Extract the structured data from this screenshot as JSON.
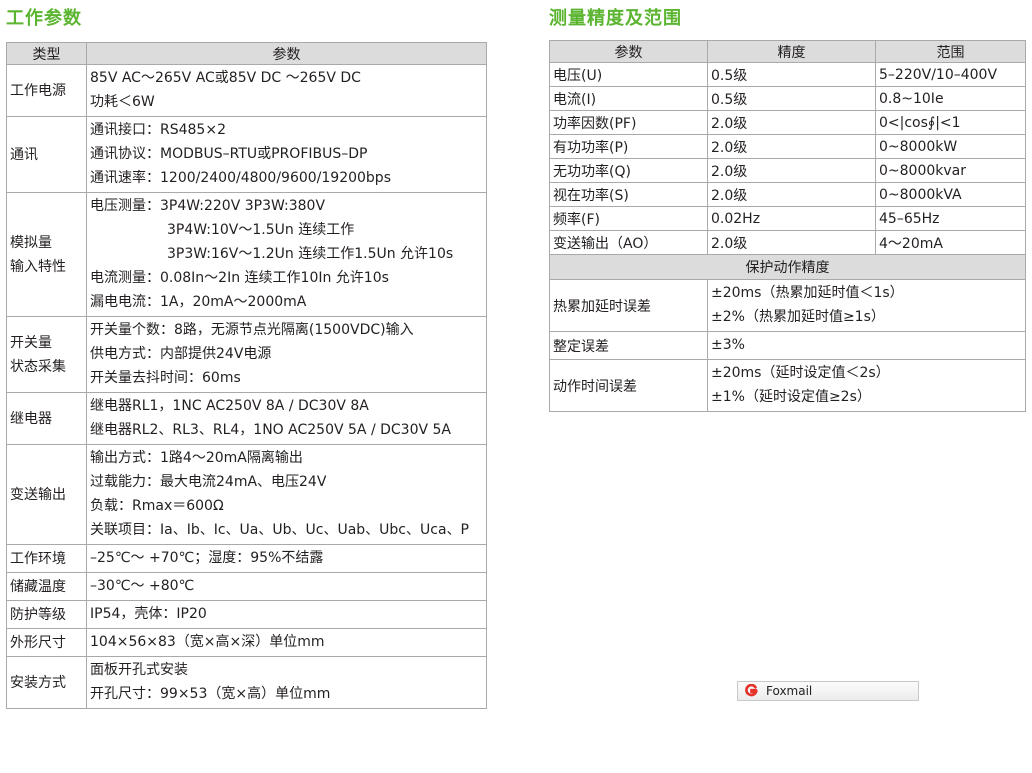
{
  "left": {
    "title": "工作参数",
    "headers": [
      "类型",
      "参数"
    ],
    "rows": [
      {
        "label": [
          "工作电源"
        ],
        "lines": [
          {
            "t": "85V AC～265V AC或85V DC ～265V DC"
          },
          {
            "t": "功耗＜6W"
          }
        ]
      },
      {
        "label": [
          "通讯"
        ],
        "lines": [
          {
            "t": "通讯接口：RS485×2"
          },
          {
            "t": "通讯协议：MODBUS–RTU或PROFIBUS–DP"
          },
          {
            "t": "通讯速率：1200/2400/4800/9600/19200bps"
          }
        ]
      },
      {
        "label": [
          "模拟量",
          "输入特性"
        ],
        "lines": [
          {
            "t": "电压测量：3P4W:220V 3P3W:380V"
          },
          {
            "t": "3P4W:10V～1.5Un 连续工作",
            "indent": true
          },
          {
            "t": "3P3W:16V～1.2Un 连续工作1.5Un 允许10s",
            "indent": true
          },
          {
            "t": "电流测量：0.08In～2In 连续工作10In 允许10s"
          },
          {
            "t": "漏电电流：1A，20mA～2000mA"
          }
        ]
      },
      {
        "label": [
          "开关量",
          "状态采集"
        ],
        "lines": [
          {
            "t": "开关量个数：8路，无源节点光隔离(1500VDC)输入"
          },
          {
            "t": "供电方式：内部提供24V电源"
          },
          {
            "t": "开关量去抖时间：60ms"
          }
        ]
      },
      {
        "label": [
          "继电器"
        ],
        "lines": [
          {
            "t": "继电器RL1，1NC AC250V 8A / DC30V 8A"
          },
          {
            "t": "继电器RL2、RL3、RL4，1NO AC250V 5A / DC30V 5A"
          }
        ]
      },
      {
        "label": [
          "变送输出"
        ],
        "lines": [
          {
            "t": "输出方式：1路4～20mA隔离输出"
          },
          {
            "t": "过载能力：最大电流24mA、电压24V"
          },
          {
            "t": "负载：Rmax＝600Ω"
          },
          {
            "t": "关联项目：Ia、Ib、Ic、Ua、Ub、Uc、Uab、Ubc、Uca、P",
            "wrap": true
          }
        ]
      },
      {
        "label": [
          "工作环境"
        ],
        "lines": [
          {
            "t": "–25℃～ +70℃；湿度：95%不结露"
          }
        ]
      },
      {
        "label": [
          "储藏温度"
        ],
        "lines": [
          {
            "t": "–30℃～ +80℃"
          }
        ]
      },
      {
        "label": [
          "防护等级"
        ],
        "lines": [
          {
            "t": "IP54，壳体：IP20"
          }
        ]
      },
      {
        "label": [
          "外形尺寸"
        ],
        "lines": [
          {
            "t": "104×56×83（宽×高×深）单位mm"
          }
        ]
      },
      {
        "label": [
          "安装方式"
        ],
        "lines": [
          {
            "t": "面板开孔式安装"
          },
          {
            "t": "开孔尺寸：99×53（宽×高）单位mm"
          }
        ]
      }
    ]
  },
  "right": {
    "title": "测量精度及范围",
    "headers": [
      "参数",
      "精度",
      "范围"
    ],
    "rows": [
      [
        "电压(U)",
        "0.5级",
        "5–220V/10–400V"
      ],
      [
        "电流(I)",
        "0.5级",
        "0.8~10Ie"
      ],
      [
        "功率因数(PF)",
        "2.0级",
        "0<|cos∮|<1"
      ],
      [
        "有功功率(P)",
        "2.0级",
        "0~8000kW"
      ],
      [
        "无功功率(Q)",
        "2.0级",
        "0~8000kvar"
      ],
      [
        "视在功率(S)",
        "2.0级",
        "0~8000kVA"
      ],
      [
        "频率(F)",
        "0.02Hz",
        "45–65Hz"
      ],
      [
        "变送输出（AO）",
        "2.0级",
        "4～20mA"
      ]
    ],
    "subheader": "保护动作精度",
    "protect": [
      {
        "label": "热累加延时误差",
        "lines": [
          "±20ms（热累加延时值＜1s）",
          "±2%（热累加延时值≥1s）"
        ]
      },
      {
        "label": "整定误差",
        "lines": [
          "±3%"
        ]
      },
      {
        "label": "动作时间误差",
        "lines": [
          "±20ms（延时设定值＜2s）",
          "±1%（延时设定值≥2s）"
        ]
      }
    ]
  },
  "foxmail": {
    "label": "Foxmail",
    "icon": "foxmail-logo-icon",
    "color": "#e4322b"
  }
}
